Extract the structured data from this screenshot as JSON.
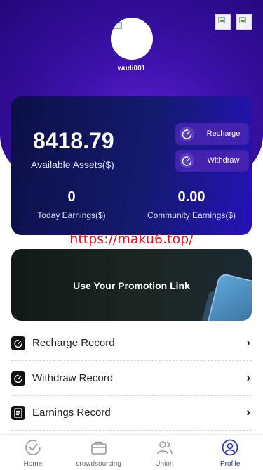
{
  "header": {
    "username": "wudi001",
    "icons": [
      "broken-image-icon",
      "broken-image-icon"
    ]
  },
  "assets_card": {
    "amount": "8418.79",
    "amount_label": "Available Assets($)",
    "recharge_label": "Recharge",
    "withdraw_label": "Withdraw",
    "today_earnings_value": "0",
    "today_earnings_label": "Today Earnings($)",
    "community_earnings_value": "0.00",
    "community_earnings_label": "Community Earnings($)"
  },
  "watermark": "https://maku6.top/",
  "promo": {
    "label": "Use Your Promotion Link"
  },
  "menu": [
    {
      "label": "Recharge Record",
      "icon": "check-icon"
    },
    {
      "label": "Withdraw Record",
      "icon": "check-icon"
    },
    {
      "label": "Earnings Record",
      "icon": "document-icon"
    }
  ],
  "chevron": "›",
  "tabbar": [
    {
      "label": "Home",
      "icon": "check-circle-icon",
      "active": false
    },
    {
      "label": "crowdsourcing",
      "icon": "briefcase-icon",
      "active": false
    },
    {
      "label": "Union",
      "icon": "users-icon",
      "active": false
    },
    {
      "label": "Profile",
      "icon": "user-circle-icon",
      "active": true
    }
  ],
  "colors": {
    "hero": "#3a10a6",
    "card": "#141a6e",
    "action_button": "#4322b0",
    "watermark": "#e3101a",
    "active_tab": "#2a3aa8"
  }
}
